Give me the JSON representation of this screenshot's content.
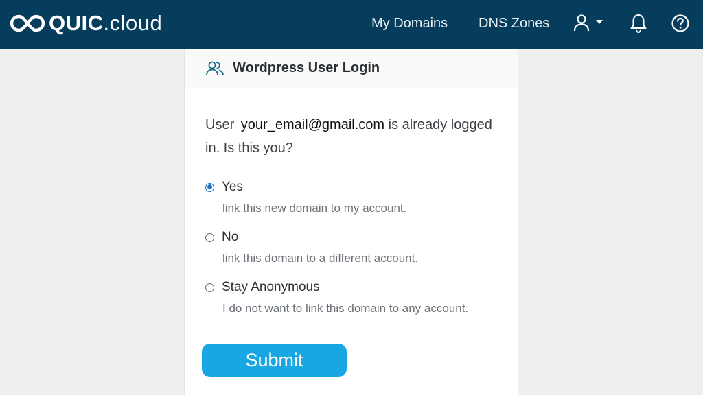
{
  "header": {
    "logo_brand": "QUIC",
    "logo_tld": ".cloud",
    "nav": {
      "my_domains": "My Domains",
      "dns_zones": "DNS Zones"
    },
    "icons": [
      "user-icon",
      "caret-down-icon",
      "bell-icon",
      "help-icon"
    ],
    "background_color": "#073d5c"
  },
  "card": {
    "title": "Wordpress User Login",
    "question_prefix": "User",
    "email": "your_email@gmail.com",
    "question_suffix": "is already logged in. Is this you?",
    "options": [
      {
        "label": "Yes",
        "description": "link this new domain to my account.",
        "selected": true
      },
      {
        "label": "No",
        "description": "link this domain to a different account.",
        "selected": false
      },
      {
        "label": "Stay Anonymous",
        "description": "I do not want to link this domain to any account.",
        "selected": false
      }
    ],
    "submit_label": "Submit",
    "accent_color": "#19a7e3"
  }
}
